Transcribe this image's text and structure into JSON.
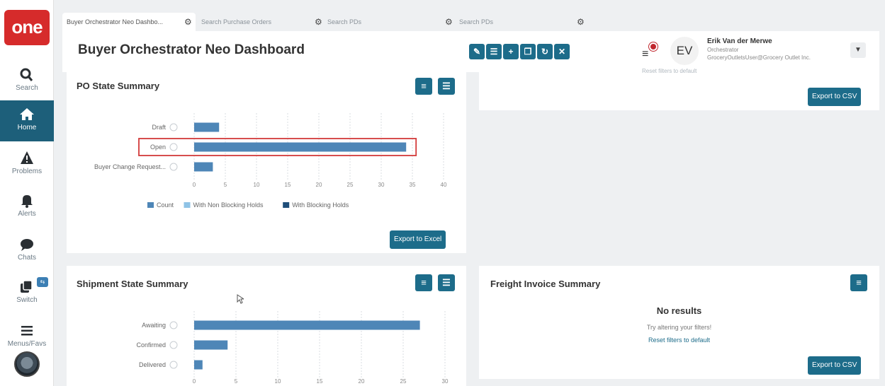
{
  "app": {
    "logo_text": "one"
  },
  "sidebar": {
    "items": [
      {
        "label": "Search",
        "icon": "search-icon"
      },
      {
        "label": "Home",
        "icon": "home-icon",
        "active": true
      },
      {
        "label": "Problems",
        "icon": "warning-icon"
      },
      {
        "label": "Alerts",
        "icon": "bell-icon"
      },
      {
        "label": "Chats",
        "icon": "chat-icon"
      },
      {
        "label": "Switch",
        "icon": "switch-icon"
      },
      {
        "label": "Menus/Favs",
        "icon": "hamburger-icon"
      }
    ]
  },
  "tabs": [
    {
      "label": "Buyer Orchestrator Neo Dashbo...",
      "active": true
    },
    {
      "label": "Search Purchase Orders"
    },
    {
      "label": "Search PDs"
    },
    {
      "label": "Search PDs"
    }
  ],
  "header": {
    "title": "Buyer Orchestrator Neo Dashboard",
    "user": {
      "initials": "EV",
      "name": "Erik Van der Merwe",
      "role": "Orchestrator",
      "org": "GroceryOutletsUser@Grocery Outlet Inc."
    }
  },
  "po_card": {
    "title": "PO State Summary",
    "export_label": "Export to Excel",
    "legend": [
      "Count",
      "With Non Blocking Holds",
      "With Blocking Holds"
    ],
    "legend_colors": [
      "#4e86b7",
      "#8fc3e6",
      "#1f4e79"
    ]
  },
  "top_right_card": {
    "faint_text": "Reset filters to default",
    "export_label": "Export to CSV"
  },
  "shipment_card": {
    "title": "Shipment State Summary"
  },
  "freight_card": {
    "title": "Freight Invoice Summary",
    "no_results": "No results",
    "hint": "Try altering your filters!",
    "reset_link": "Reset filters to default",
    "export_label": "Export to CSV"
  },
  "chart_data": [
    {
      "type": "bar",
      "orientation": "horizontal",
      "title": "PO State Summary",
      "categories": [
        "Draft",
        "Open",
        "Buyer Change Request..."
      ],
      "series": [
        {
          "name": "Count",
          "values": [
            4,
            34,
            3
          ]
        },
        {
          "name": "With Non Blocking Holds",
          "values": [
            0,
            0,
            0
          ]
        },
        {
          "name": "With Blocking Holds",
          "values": [
            0,
            0,
            0
          ]
        }
      ],
      "xticks": [
        0,
        5,
        10,
        15,
        20,
        25,
        30,
        35,
        40
      ],
      "xlim": [
        0,
        40
      ],
      "grid": true,
      "highlighted_category": "Open"
    },
    {
      "type": "bar",
      "orientation": "horizontal",
      "title": "Shipment State Summary",
      "categories": [
        "Awaiting",
        "Confirmed",
        "Delivered"
      ],
      "series": [
        {
          "name": "Count",
          "values": [
            27,
            4,
            1
          ]
        }
      ],
      "xticks": [
        0,
        5,
        10,
        15,
        20,
        25,
        30
      ],
      "xlim": [
        0,
        30
      ],
      "grid": true
    }
  ]
}
